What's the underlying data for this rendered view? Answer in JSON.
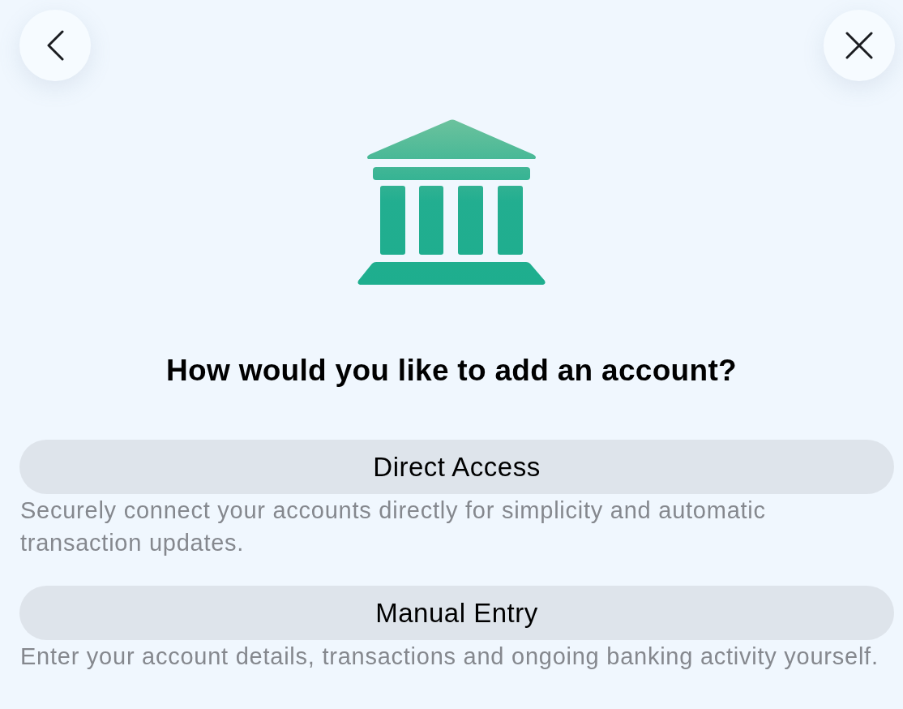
{
  "title": "How would you like to add an account?",
  "options": [
    {
      "label": "Direct Access",
      "description": "Securely connect your accounts directly for simplicity and automatic transaction updates."
    },
    {
      "label": "Manual Entry",
      "description": "Enter your account details, transactions and ongoing banking activity yourself."
    }
  ]
}
